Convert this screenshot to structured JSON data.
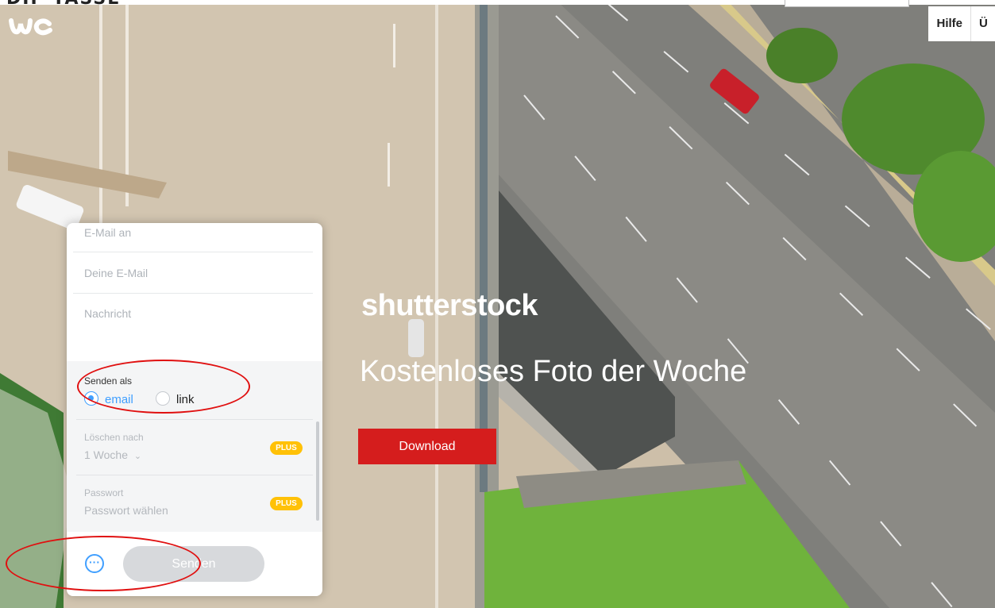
{
  "top": {
    "cut_text": "DIP TASSE"
  },
  "header": {
    "help_label": "Hilfe",
    "next_label": "Ü"
  },
  "ad": {
    "brand": "shutterstock",
    "headline": "Kostenloses Foto der Woche",
    "download_label": "Download",
    "button_color": "#d51d1d"
  },
  "form": {
    "email_to_placeholder": "E-Mail an",
    "your_email_placeholder": "Deine E-Mail",
    "message_placeholder": "Nachricht",
    "send_as": {
      "label": "Senden als",
      "options": [
        "email",
        "link"
      ],
      "selected": "email"
    },
    "delete_after": {
      "label": "Löschen nach",
      "value": "1 Woche",
      "badge": "PLUS"
    },
    "password": {
      "label": "Passwort",
      "value": "Passwort wählen",
      "badge": "PLUS"
    },
    "more_icon": "ellipsis-icon",
    "send_label": "Senden"
  },
  "colors": {
    "accent": "#409fff",
    "plus_badge": "#ffc107",
    "annotation": "#e01010"
  }
}
